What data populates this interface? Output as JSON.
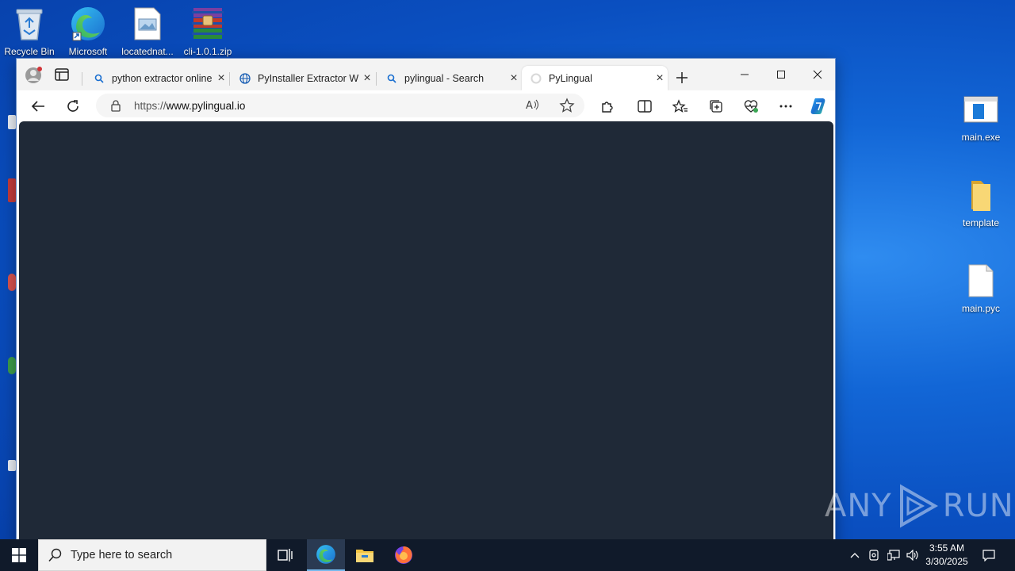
{
  "desktop": {
    "icons_left": [
      {
        "label": "Recycle Bin",
        "icon": "recycle-bin-icon"
      },
      {
        "label": "Microsoft",
        "icon": "edge-icon"
      },
      {
        "label": "locatednat...",
        "icon": "image-file-icon"
      },
      {
        "label": "cli-1.0.1.zip",
        "icon": "winrar-archive-icon"
      }
    ],
    "icons_right": [
      {
        "label": "main.exe",
        "icon": "exe-file-icon"
      },
      {
        "label": "template",
        "icon": "folder-icon"
      },
      {
        "label": "main.pyc",
        "icon": "blank-file-icon"
      }
    ]
  },
  "browser": {
    "tabs": [
      {
        "title": "python extractor online",
        "icon": "search-icon",
        "close": "×"
      },
      {
        "title": "PyInstaller Extractor WEB",
        "icon": "globe-icon",
        "close": "×"
      },
      {
        "title": "pylingual - Search",
        "icon": "search-icon",
        "close": "×"
      },
      {
        "title": "PyLingual",
        "icon": "loading-icon",
        "close": "×",
        "active": true
      }
    ],
    "new_tab": "+",
    "address": {
      "scheme": "https://",
      "host": "www.pylingual.io",
      "read_aloud": "Aᴬ"
    },
    "content_bg": "#1f2937"
  },
  "watermark": {
    "text_left": "ANY",
    "text_right": "RUN"
  },
  "taskbar": {
    "search_placeholder": "Type here to search",
    "clock_time": "3:55 AM",
    "clock_date": "3/30/2025"
  },
  "colors": {
    "desktop_blue": "#0a4fc0",
    "taskbar": "#101a2a",
    "accent": "#0078d4"
  }
}
